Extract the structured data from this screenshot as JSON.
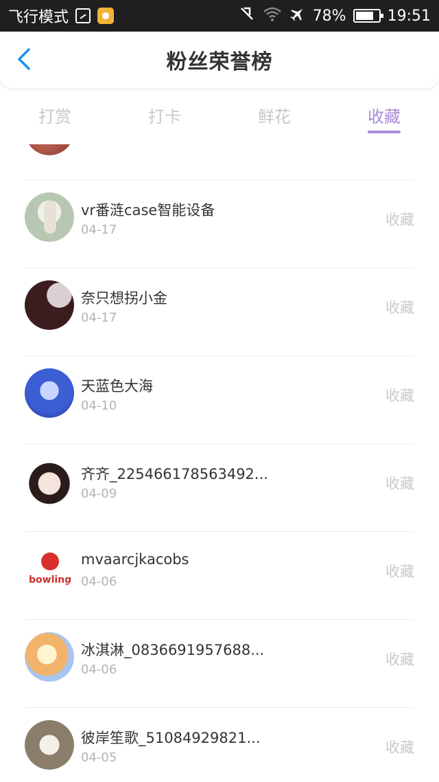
{
  "status_bar": {
    "mode_text": "飞行模式",
    "battery_text": "78%",
    "battery_level": 0.78,
    "time": "19:51",
    "icons": [
      "image-icon",
      "app-notification-icon",
      "mute-icon",
      "wifi-icon",
      "airplane-icon",
      "battery-icon"
    ]
  },
  "header": {
    "title": "粉丝荣誉榜",
    "back_icon": "chevron-left-icon"
  },
  "tabs": [
    {
      "label": "打赏",
      "active": false
    },
    {
      "label": "打卡",
      "active": false
    },
    {
      "label": "鲜花",
      "active": false
    },
    {
      "label": "收藏",
      "active": true
    }
  ],
  "colors": {
    "accent": "#a78bd6",
    "inactive_tab": "#c8c8c8",
    "action_text": "#c9c9c9"
  },
  "list": {
    "items": [
      {
        "name": "vr番涟case智能设备",
        "date": "04-17",
        "action": "收藏",
        "avatar": "cat-avatar"
      },
      {
        "name": "奈只想拐小金",
        "date": "04-17",
        "action": "收藏",
        "avatar": "dark-portrait-avatar"
      },
      {
        "name": "天蓝色大海",
        "date": "04-10",
        "action": "收藏",
        "avatar": "blue-avatar"
      },
      {
        "name": "齐齐_225466178563492...",
        "date": "04-09",
        "action": "收藏",
        "avatar": "girl-avatar"
      },
      {
        "name": "mvaarcjkacobs",
        "date": "04-06",
        "action": "收藏",
        "avatar": "bowling-avatar",
        "avatar_text": "bowling"
      },
      {
        "name": "冰淇淋_0836691957688...",
        "date": "04-06",
        "action": "收藏",
        "avatar": "anime-avatar"
      },
      {
        "name": "彼岸笙歌_51084929821...",
        "date": "04-05",
        "action": "收藏",
        "avatar": "chick-avatar"
      }
    ]
  }
}
